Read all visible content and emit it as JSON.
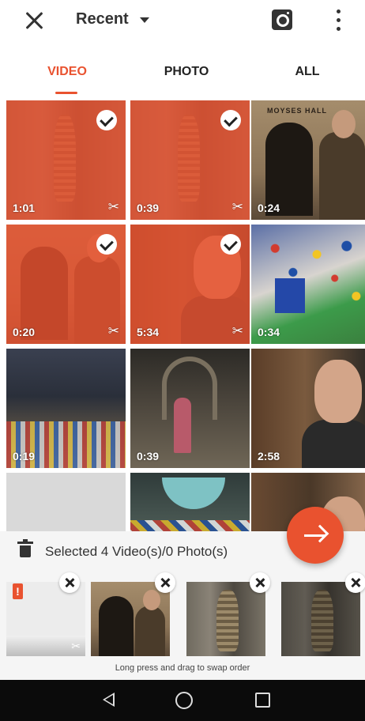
{
  "header": {
    "close_icon": "close-icon",
    "album_label": "Recent",
    "camera_icon": "camera-icon",
    "more_icon": "more-vert-icon"
  },
  "tabs": [
    {
      "label": "VIDEO",
      "active": true
    },
    {
      "label": "PHOTO",
      "active": false
    },
    {
      "label": "ALL",
      "active": false
    }
  ],
  "grid": {
    "items": [
      {
        "duration": "1:01",
        "selected": true,
        "scene": "statue"
      },
      {
        "duration": "0:39",
        "selected": true,
        "scene": "statue"
      },
      {
        "duration": "0:24",
        "selected": false,
        "scene": "hall"
      },
      {
        "duration": "0:20",
        "selected": true,
        "scene": "hall"
      },
      {
        "duration": "5:34",
        "selected": true,
        "scene": "face"
      },
      {
        "duration": "0:34",
        "selected": false,
        "scene": "lego"
      },
      {
        "duration": "0:19",
        "selected": false,
        "scene": "workshop"
      },
      {
        "duration": "0:39",
        "selected": false,
        "scene": "church"
      },
      {
        "duration": "2:58",
        "selected": false,
        "scene": "face"
      },
      {
        "duration": "",
        "selected": false,
        "scene": "blank"
      },
      {
        "duration": "",
        "selected": false,
        "scene": "bowl"
      },
      {
        "duration": "",
        "selected": false,
        "scene": "face2"
      }
    ],
    "hall_sign": "MOYSES HALL"
  },
  "fab": {
    "icon": "arrow-right-icon"
  },
  "selection": {
    "label": "Selected 4 Video(s)/0 Photo(s)",
    "trash_icon": "trash-icon",
    "warning_glyph": "!",
    "hint": "Long press and drag to swap order"
  },
  "colors": {
    "accent": "#e9522f",
    "nav_bar": "#0b0b0b"
  }
}
